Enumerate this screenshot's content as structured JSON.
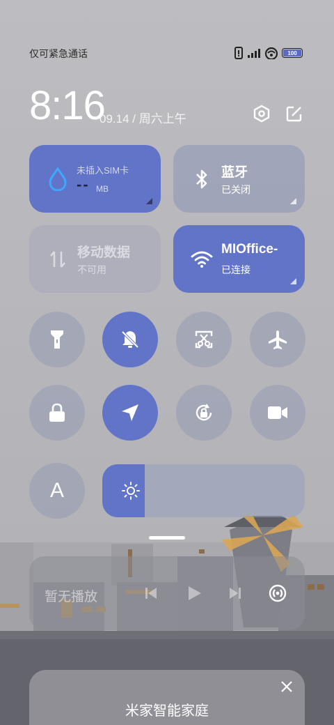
{
  "status_bar": {
    "carrier_text": "仅可紧急通话",
    "battery_level": "100"
  },
  "header": {
    "time": "8:16",
    "date": "09.14 / 周六上午",
    "icons": [
      "settings-icon",
      "edit-icon"
    ]
  },
  "tiles": {
    "data_usage": {
      "title": "未插入SIM卡",
      "value": "--",
      "unit": "MB"
    },
    "bluetooth": {
      "title": "蓝牙",
      "status": "已关闭"
    },
    "mobile_data": {
      "title": "移动数据",
      "status": "不可用"
    },
    "wifi": {
      "title": "MIOffice-",
      "status": "已连接"
    }
  },
  "toggles": [
    {
      "name": "flashlight",
      "icon": "flashlight-icon",
      "active": false
    },
    {
      "name": "mute",
      "icon": "bell-off-icon",
      "active": true
    },
    {
      "name": "screenshot",
      "icon": "scissors-icon",
      "active": false
    },
    {
      "name": "airplane-mode",
      "icon": "airplane-icon",
      "active": false
    },
    {
      "name": "lock-screen",
      "icon": "lock-icon",
      "active": false
    },
    {
      "name": "location",
      "icon": "navigation-icon",
      "active": true
    },
    {
      "name": "rotation-lock",
      "icon": "rotation-lock-icon",
      "active": false
    },
    {
      "name": "screen-recorder",
      "icon": "video-camera-icon",
      "active": false
    },
    {
      "name": "font-size",
      "icon": "letter-a-icon",
      "label": "A",
      "active": false
    }
  ],
  "brightness": {
    "level": 0.21,
    "icon": "sun-icon"
  },
  "media": {
    "status": "暂无播放",
    "controls": [
      "previous-icon",
      "play-icon",
      "next-icon",
      "cast-icon"
    ]
  },
  "card": {
    "title": "米家智能家庭"
  },
  "colors": {
    "accent": "#6274c7",
    "background": "#b9b9bd"
  }
}
